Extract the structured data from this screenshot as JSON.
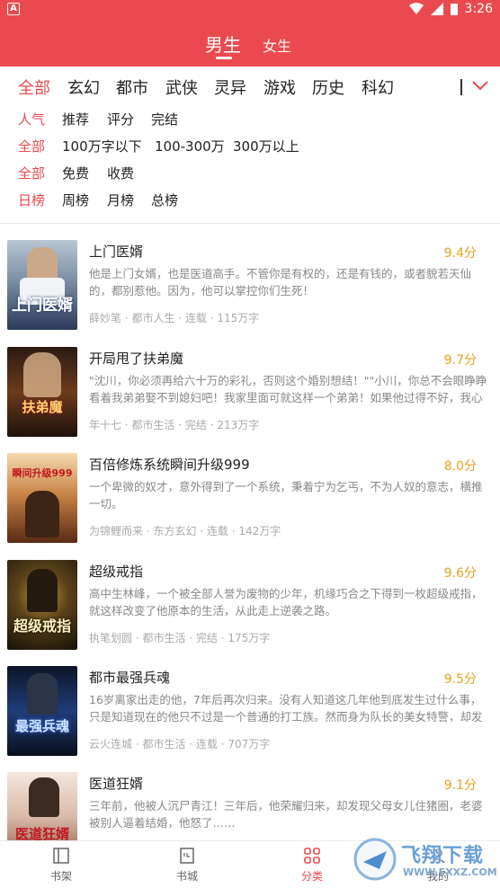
{
  "status": {
    "left_icon": "A",
    "time": "3:26"
  },
  "header": {
    "tabs": [
      "男生",
      "女生"
    ],
    "active": "男生"
  },
  "categories": [
    "全部",
    "玄幻",
    "都市",
    "武侠",
    "灵异",
    "游戏",
    "历史",
    "科幻"
  ],
  "filters": [
    [
      "人气",
      "推荐",
      "评分",
      "完结"
    ],
    [
      "全部",
      "100万字以下",
      "100-300万",
      "300万以上"
    ],
    [
      "全部",
      "免费",
      "收费"
    ],
    [
      "日榜",
      "周榜",
      "月榜",
      "总榜"
    ]
  ],
  "books": [
    {
      "title": "上门医婿",
      "score": "9.4分",
      "desc": "他是上门女婿，也是医道高手。不管你是有权的，还是有钱的，或者貌若天仙的，都别惹他。因为，他可以掌控你们生死！",
      "meta": "薛妙笔 · 都市人生 · 连载 · 115万字",
      "cover_text": "上门医婿"
    },
    {
      "title": "开局甩了扶弟魔",
      "score": "9.7分",
      "desc": "\"沈川，你必须再给六十万的彩礼，否则这个婚别想结！\"\"小川，你总不会眼睁睁看着我弟弟娶不到媳妇吧！我家里面可就这样一个弟弟！如果他过得不好，我心里...",
      "meta": "年十七 · 都市生活 · 完结 · 213万字",
      "cover_text": "扶弟魔"
    },
    {
      "title": "百倍修炼系统瞬间升级999",
      "score": "8.0分",
      "desc": "一个卑微的奴才，意外得到了一个系统，秉着宁为乞丐，不为人奴的意志，横推一切。",
      "meta": "为锦鲤而来 · 东方玄幻 · 连载 · 142万字",
      "cover_text": "瞬间升级999"
    },
    {
      "title": "超级戒指",
      "score": "9.6分",
      "desc": "高中生林峰，一个被全部人誉为废物的少年，机缘巧合之下得到一枚超级戒指，就这样改变了他原本的生活，从此走上逆袭之路。",
      "meta": "执笔划圆 · 都市生活 · 完结 · 175万字",
      "cover_text": "超级戒指"
    },
    {
      "title": "都市最强兵魂",
      "score": "9.5分",
      "desc": "16岁离家出走的他，7年后再次归来。没有人知道这几年他到底发生过什么事，只是知道现在的他只不过是一个普通的打工族。然而身为队长的美女特警，却发现...",
      "meta": "云火连城 · 都市生活 · 连载 · 707万字",
      "cover_text": "最强兵魂"
    },
    {
      "title": "医道狂婿",
      "score": "9.1分",
      "desc": "三年前，他被人沉尸青江！三年后，他荣耀归来，却发现父母女儿住猪圈，老婆被别人逼着结婚，他怒了……",
      "meta": "",
      "cover_text": "医道狂婿"
    }
  ],
  "nav": [
    {
      "label": "书架",
      "icon": "bookshelf-icon"
    },
    {
      "label": "书城",
      "icon": "bookstore-icon"
    },
    {
      "label": "分类",
      "icon": "grid-icon"
    },
    {
      "label": "我的",
      "icon": "profile-icon"
    }
  ],
  "watermark": {
    "text": "飞翔下载",
    "url": "WWW.FXXZ.COM"
  },
  "colors": {
    "accent": "#ea4a4f",
    "score": "#e6a21f"
  }
}
